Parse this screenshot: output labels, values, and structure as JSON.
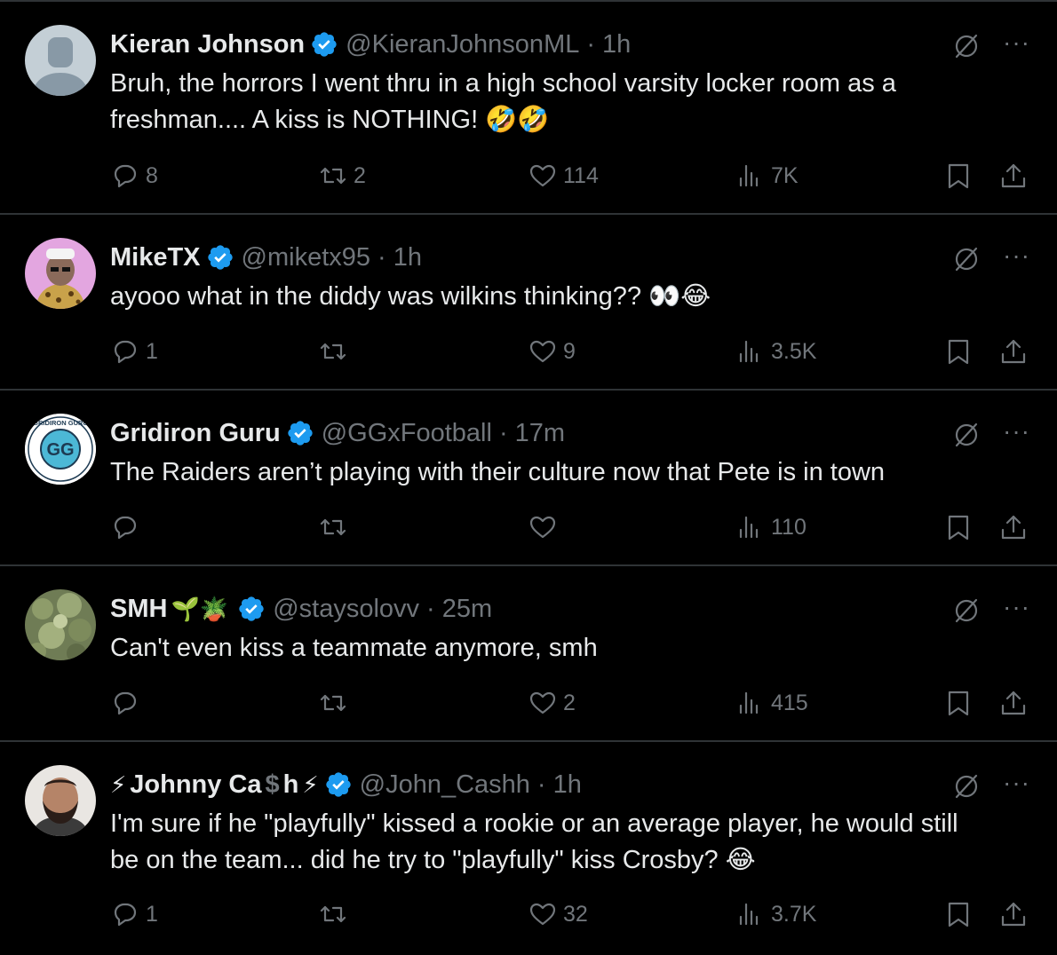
{
  "tweets": [
    {
      "name": "Kieran Johnson",
      "handle": "@KieranJohnsonML",
      "time": "1h",
      "text_lines": [
        "Bruh, the horrors I went thru in a high school varsity locker room as a",
        "freshman.... A kiss is NOTHING! 🤣🤣"
      ],
      "replies": "8",
      "retweets": "2",
      "likes": "114",
      "views": "7K",
      "avatar": "default-avatar"
    },
    {
      "name": "MikeTX",
      "handle": "@miketx95",
      "time": "1h",
      "text_lines": [
        "ayooo what in the diddy was wilkins thinking?? 👀😂"
      ],
      "replies": "1",
      "retweets": "",
      "likes": "9",
      "views": "3.5K",
      "avatar": "nft-leopard-avatar"
    },
    {
      "name": "Gridiron Guru",
      "handle": "@GGxFootball",
      "time": "17m",
      "text_lines": [
        "The Raiders aren’t playing with their culture now that Pete is in town"
      ],
      "replies": "",
      "retweets": "",
      "likes": "",
      "views": "110",
      "avatar": "gg-logo-avatar",
      "avatar_text": "GG",
      "avatar_ring_text": "GRIDIRON GURU"
    },
    {
      "name": "SMH",
      "name_emoji": "🌱🪴",
      "handle": "@staysolovv",
      "time": "25m",
      "text_lines": [
        "Can't even kiss a teammate anymore, smh"
      ],
      "replies": "",
      "retweets": "",
      "likes": "2",
      "views": "415",
      "avatar": "plant-photo-avatar"
    },
    {
      "name_prefix": "⚡",
      "name": "Johnny Ca",
      "name_mid": "$",
      "name_tail": "h",
      "name_suffix": "⚡",
      "handle": "@John_Cashh",
      "time": "1h",
      "text_lines": [
        "I'm sure if he \"playfully\" kissed a rookie or an average player, he would still",
        "be on the team... did he try to \"playfully\" kiss Crosby? 😂"
      ],
      "replies": "1",
      "retweets": "",
      "likes": "32",
      "views": "3.7K",
      "avatar": "bearded-man-avatar"
    }
  ],
  "colors": {
    "background": "#000000",
    "text": "#e7e9ea",
    "muted": "#71767b",
    "verified": "#1d9bf0",
    "divider": "#2f3336"
  },
  "icons": [
    "verified-badge-icon",
    "grok-icon",
    "more-icon",
    "reply-icon",
    "retweet-icon",
    "like-icon",
    "views-icon",
    "bookmark-icon",
    "share-icon"
  ]
}
